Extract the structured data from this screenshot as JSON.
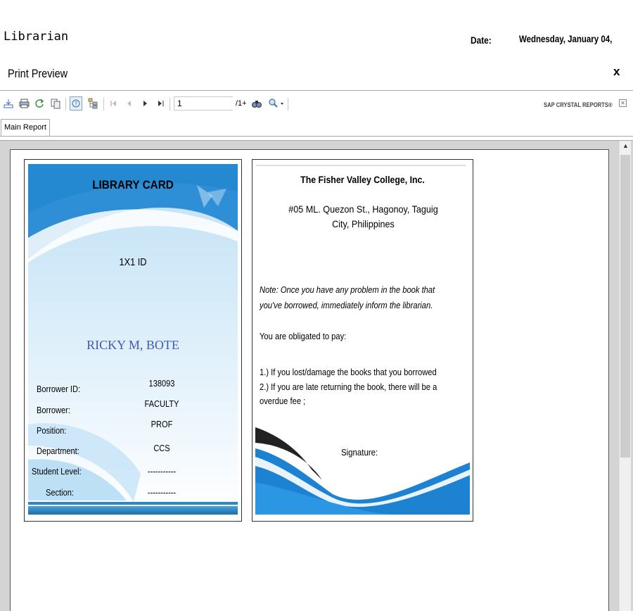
{
  "header": {
    "user": "Librarian",
    "date_label": "Date:",
    "date_value": "Wednesday, January 04,"
  },
  "preview": {
    "title": "Print Preview",
    "close": "x"
  },
  "toolbar": {
    "icons": [
      "export-icon",
      "print-icon",
      "refresh-icon",
      "copy-icon",
      "help-icon",
      "group-tree-icon",
      "first-page-icon",
      "prev-page-icon",
      "next-page-icon",
      "last-page-icon",
      "find-icon",
      "zoom-icon"
    ],
    "page_value": "1",
    "page_total": "/1+",
    "brand": "SAP CRYSTAL REPORTS®"
  },
  "tabs": {
    "main": "Main Report"
  },
  "front": {
    "title": "LIBRARY CARD",
    "photo": "1X1 ID",
    "name": "RICKY M, BOTE",
    "fields": [
      {
        "label": "Borrower ID:",
        "value": "138093"
      },
      {
        "label": "Borrower:",
        "value": "FACULTY"
      },
      {
        "label": "Position:",
        "value": "PROF"
      },
      {
        "label": "Department:",
        "value": "CCS"
      },
      {
        "label": "Student Level:",
        "value": "-----------"
      },
      {
        "label": "Section:",
        "value": "-----------"
      }
    ]
  },
  "back": {
    "school": "The Fisher Valley College, Inc.",
    "address_line1": "#05 ML. Quezon St., Hagonoy, Taguig",
    "address_line2": "City, Philippines",
    "note": "Note: Once you have any problem in the book that you've borrowed, immediately inform the librarian.",
    "obligation": "You are obligated to pay:",
    "rule1": "1.) If you lost/damage the books that you borrowed",
    "rule2": "2.) If you are late returning the book, there will be a overdue fee ;",
    "signature": "Signature:"
  },
  "colors": {
    "accent_blue": "#2b87c6",
    "name_blue": "#3c5bb8"
  }
}
